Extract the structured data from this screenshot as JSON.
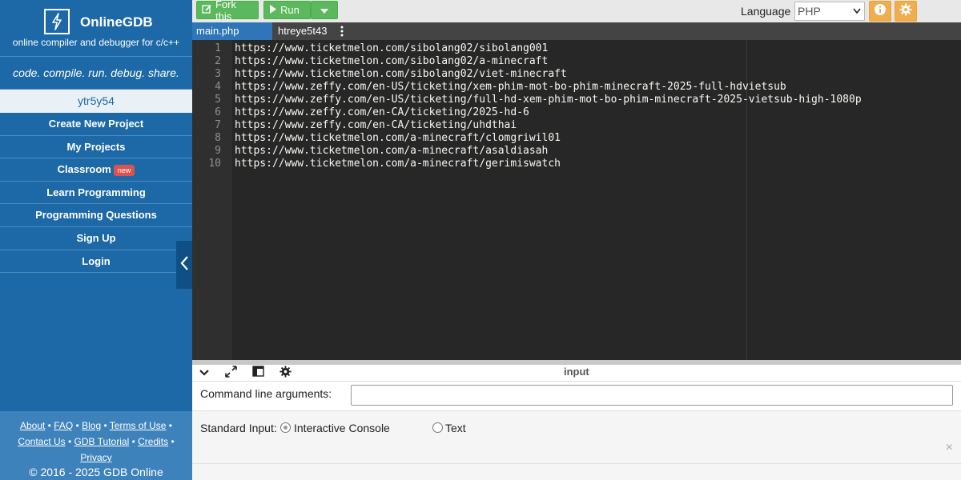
{
  "sidebar": {
    "brand": "OnlineGDB",
    "subtitle": "online compiler and debugger for c/c++",
    "tagline": "code. compile. run. debug. share.",
    "username": "ytr5y54",
    "nav": [
      {
        "label": "Create New Project"
      },
      {
        "label": "My Projects"
      },
      {
        "label": "Classroom",
        "badge": "new"
      },
      {
        "label": "Learn Programming"
      },
      {
        "label": "Programming Questions"
      },
      {
        "label": "Sign Up"
      },
      {
        "label": "Login"
      }
    ],
    "footer": {
      "about": "About",
      "faq": "FAQ",
      "blog": "Blog",
      "terms": "Terms of Use",
      "contact": "Contact Us",
      "gdb_tutorial": "GDB Tutorial",
      "credits": "Credits",
      "privacy": "Privacy",
      "copyright": "© 2016 - 2025 GDB Online"
    }
  },
  "toolbar": {
    "fork_label": "Fork this",
    "run_label": "Run",
    "language_label": "Language",
    "language_value": "PHP"
  },
  "tabs": [
    {
      "label": "main.php",
      "active": true
    },
    {
      "label": "htreye5t43",
      "active": false
    }
  ],
  "editor": {
    "lines": [
      {
        "num": "1",
        "text": "https://www.ticketmelon.com/sibolang02/sibolang001"
      },
      {
        "num": "2",
        "text": "https://www.ticketmelon.com/sibolang02/a-minecraft"
      },
      {
        "num": "3",
        "text": "https://www.ticketmelon.com/sibolang02/viet-minecraft"
      },
      {
        "num": "4",
        "text": "https://www.zeffy.com/en-US/ticketing/xem-phim-mot-bo-phim-minecraft-2025-full-hdvietsub"
      },
      {
        "num": "5",
        "text": "https://www.zeffy.com/en-US/ticketing/full-hd-xem-phim-mot-bo-phim-minecraft-2025-vietsub-high-1080p"
      },
      {
        "num": "6",
        "text": "https://www.zeffy.com/en-CA/ticketing/2025-hd-6"
      },
      {
        "num": "7",
        "text": "https://www.zeffy.com/en-CA/ticketing/uhdthai"
      },
      {
        "num": "8",
        "text": "https://www.ticketmelon.com/a-minecraft/clomgriwil01"
      },
      {
        "num": "9",
        "text": "https://www.ticketmelon.com/a-minecraft/asaldiasah"
      },
      {
        "num": "10",
        "text": "https://www.ticketmelon.com/a-minecraft/gerimiswatch"
      }
    ]
  },
  "input_panel": {
    "title": "input",
    "cla_label": "Command line arguments:",
    "cla_value": "",
    "stdin_label": "Standard Input:",
    "option_console": "Interactive Console",
    "option_text": "Text",
    "close_glyph": "×"
  },
  "colors": {
    "sidebar_bg": "#1d69a7",
    "editor_bg": "#272727",
    "run_green": "#5cb85c",
    "orange_button": "#f0ad4e",
    "badge_red": "#d9534f"
  }
}
